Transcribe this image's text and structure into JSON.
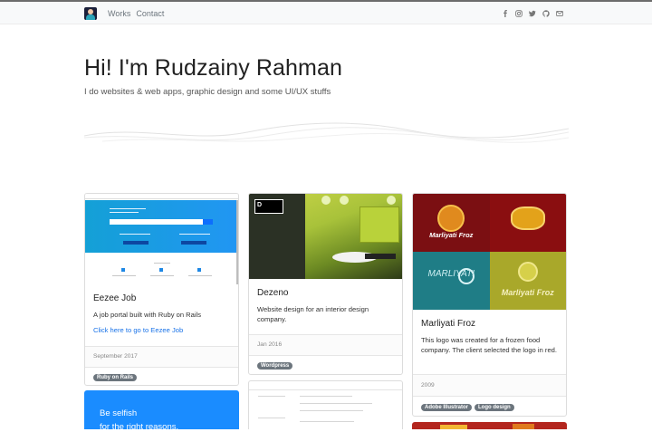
{
  "nav": {
    "links": [
      "Works",
      "Contact"
    ],
    "social_icons": [
      "facebook-icon",
      "instagram-icon",
      "twitter-icon",
      "github-icon",
      "email-icon"
    ]
  },
  "hero": {
    "title": "Hi! I'm Rudzainy Rahman",
    "subtitle": "I do websites & web apps, graphic design and some UI/UX stuffs"
  },
  "cards": [
    {
      "title": "Eezee Job",
      "text": "A job portal built with Ruby on Rails",
      "link": "Click here to go to Eezee Job",
      "date": "September 2017",
      "tags": [
        "Ruby on Rails"
      ]
    },
    {
      "title": "Dezeno",
      "text": "Website design for an interior design company.",
      "date": "Jan 2016",
      "tags": [
        "Wordpress"
      ]
    },
    {
      "title": "Marliyati Froz",
      "text": "This logo was created for a frozen food company. The client selected the logo in red.",
      "date": "2009",
      "tags": [
        "Adobe Illustrator",
        "Logo design"
      ]
    }
  ],
  "promo": {
    "line1": "Be selfish",
    "line2": "for the right reasons."
  },
  "colors": {
    "accent": "#1a8cff",
    "link": "#1a73e8",
    "tag": "#6c757d"
  }
}
